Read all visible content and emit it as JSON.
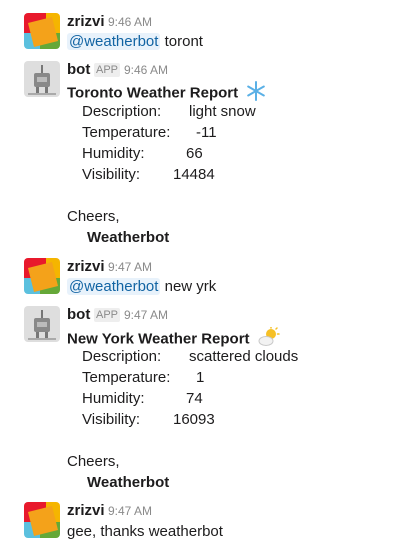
{
  "messages": [
    {
      "author": "zrizvi",
      "time": "9:46 AM",
      "mention": "@weatherbot",
      "text": " toront"
    },
    {
      "author": "bot",
      "badge": "APP",
      "time": "9:46 AM",
      "title": "Toronto Weather Report",
      "emoji": "snowflake-icon",
      "rows": [
        {
          "label": "Description:",
          "value": "light snow"
        },
        {
          "label": "Temperature:",
          "value": "-11"
        },
        {
          "label": "Humidity:",
          "value": "66"
        },
        {
          "label": "Visibility:",
          "value": "14484"
        }
      ],
      "closing": "Cheers,",
      "signature": "Weatherbot"
    },
    {
      "author": "zrizvi",
      "time": "9:47 AM",
      "mention": "@weatherbot",
      "text": " new yrk"
    },
    {
      "author": "bot",
      "badge": "APP",
      "time": "9:47 AM",
      "title": "New York Weather Report",
      "emoji": "sun-behind-cloud-icon",
      "rows": [
        {
          "label": "Description:",
          "value": "scattered clouds"
        },
        {
          "label": "Temperature:",
          "value": "1"
        },
        {
          "label": "Humidity:",
          "value": "74"
        },
        {
          "label": "Visibility:",
          "value": "16093"
        }
      ],
      "closing": "Cheers,",
      "signature": "Weatherbot"
    },
    {
      "author": "zrizvi",
      "time": "9:47 AM",
      "text": "gee, thanks weatherbot"
    }
  ],
  "colors": {
    "mention": "#1264a3",
    "mention_bg": "#e8f2fb",
    "muted": "#8a8a8a"
  }
}
